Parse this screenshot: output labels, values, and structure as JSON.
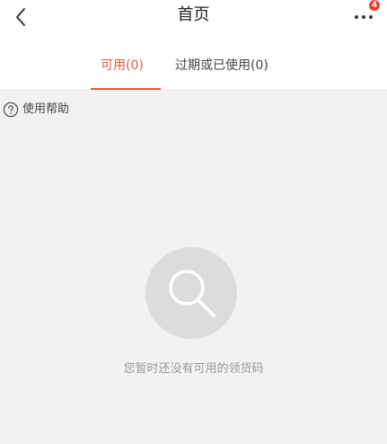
{
  "header": {
    "title": "首页",
    "notification_count": "4"
  },
  "tabs": [
    {
      "label": "可用(0)"
    },
    {
      "label": "过期或已使用(0)"
    }
  ],
  "help": {
    "label": "使用帮助"
  },
  "empty_state": {
    "message": "您暂时还没有可用的领货码"
  },
  "colors": {
    "accent": "#e4573d",
    "badge": "#ef3b2d",
    "background": "#f2f2f2"
  },
  "icons": {
    "back": "back-arrow-icon",
    "more": "more-dots-icon",
    "help": "question-circle-icon",
    "empty": "search-icon"
  }
}
